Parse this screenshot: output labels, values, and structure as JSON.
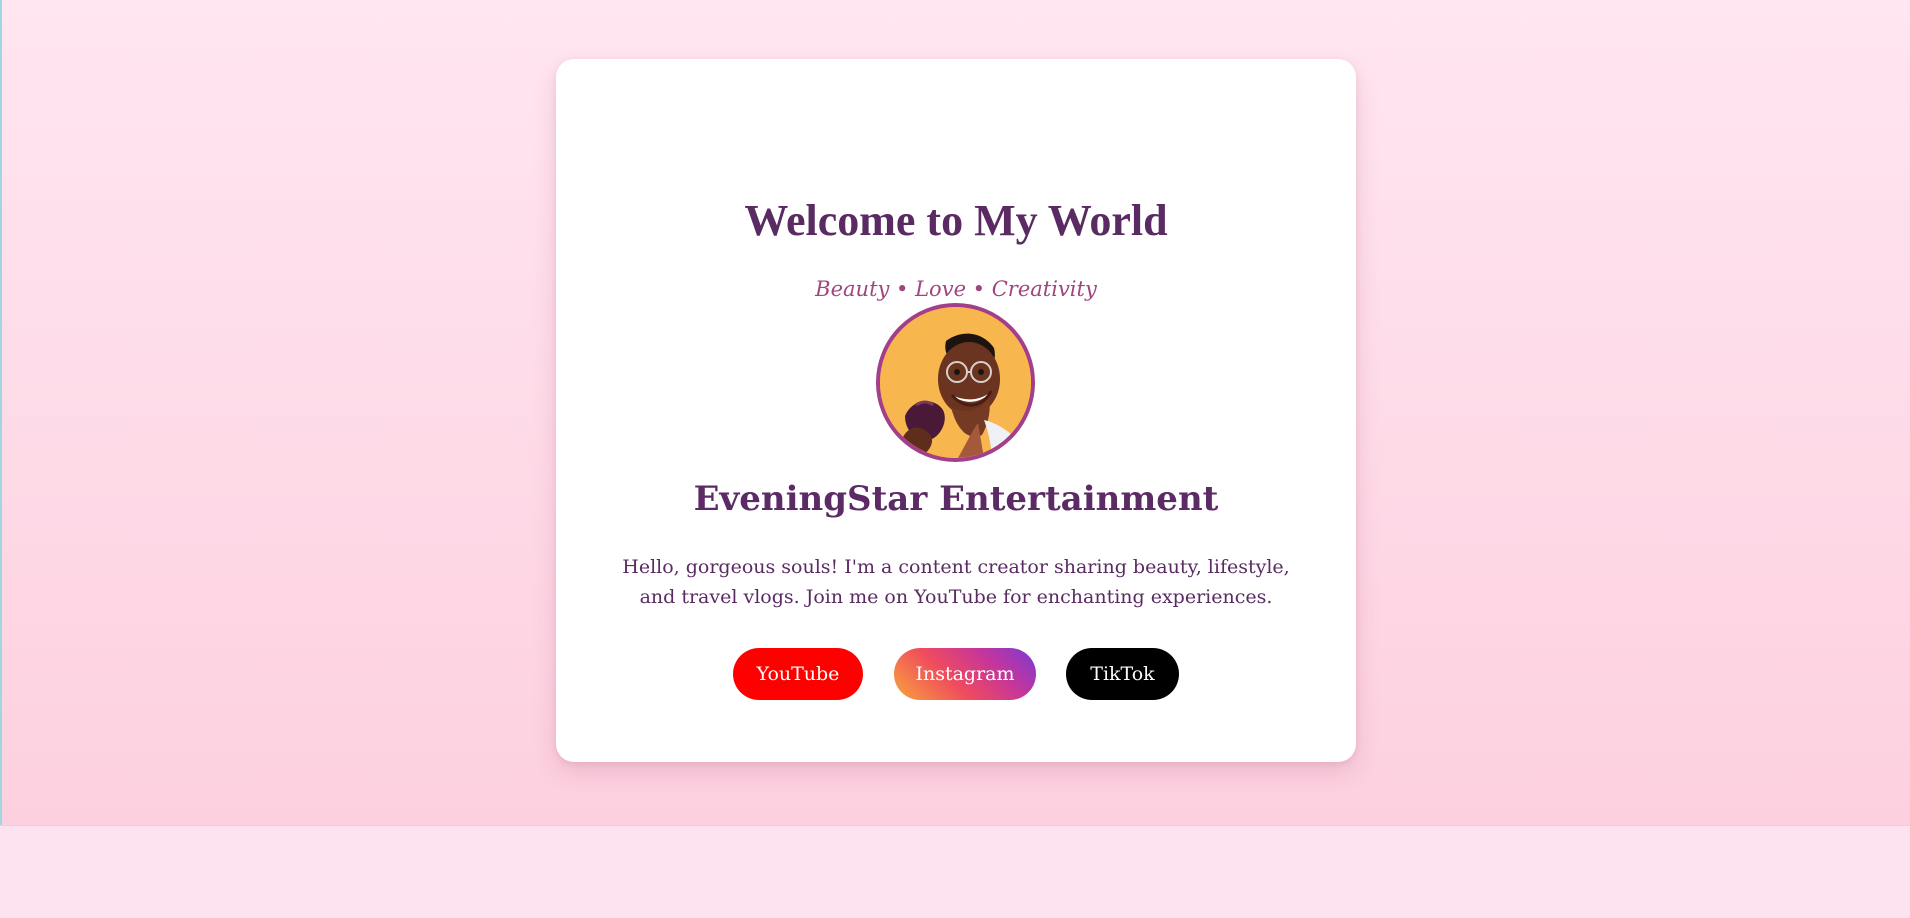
{
  "header": {
    "title": "Welcome to My World",
    "tagline": "Beauty • Love • Creativity"
  },
  "profile": {
    "avatar_icon": "profile-photo",
    "name": "EveningStar Entertainment",
    "bio": "Hello, gorgeous souls! I'm a content creator sharing beauty, lifestyle, and travel vlogs. Join me on YouTube for enchanting experiences."
  },
  "socials": {
    "youtube_label": "YouTube",
    "instagram_label": "Instagram",
    "tiktok_label": "TikTok"
  },
  "colors": {
    "title": "#5a2b63",
    "tagline": "#a0467f",
    "avatar_border": "#a33f8a",
    "youtube": "#ff0000",
    "tiktok": "#000000",
    "background_top": "#ffe6f1",
    "background_bottom": "#fdd0df"
  }
}
